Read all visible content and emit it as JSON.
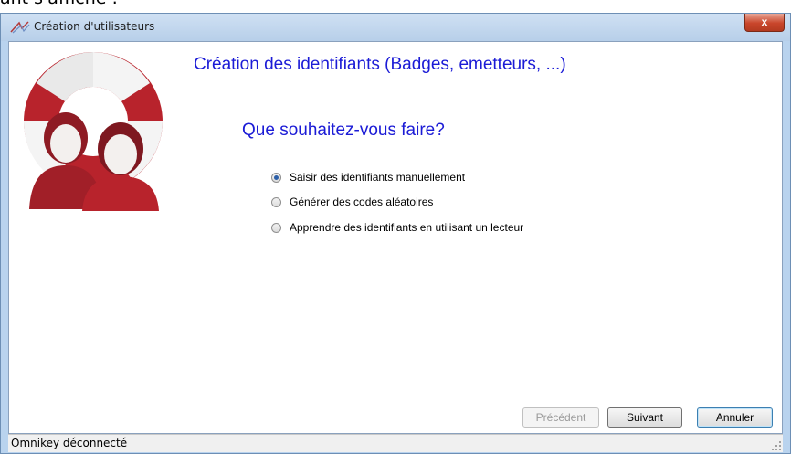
{
  "doc_fragment": "ant s'affiche :",
  "window": {
    "title": "Création d'utilisateurs",
    "close_label": "x"
  },
  "wizard": {
    "heading": "Création des identifiants (Badges, emetteurs, ...)",
    "question": "Que souhaitez-vous faire?",
    "options": [
      {
        "label": "Saisir des identifiants manuellement",
        "selected": true
      },
      {
        "label": "Générer des codes aléatoires",
        "selected": false
      },
      {
        "label": "Apprendre des identifiants en utilisant un lecteur",
        "selected": false
      }
    ]
  },
  "buttons": {
    "previous": "Précédent",
    "next": "Suivant",
    "cancel": "Annuler"
  },
  "status": {
    "text": "Omnikey déconnecté"
  },
  "colors": {
    "heading": "#1b1bd6",
    "logo_red": "#b8232c",
    "titlebar": "#b9d3ee"
  }
}
